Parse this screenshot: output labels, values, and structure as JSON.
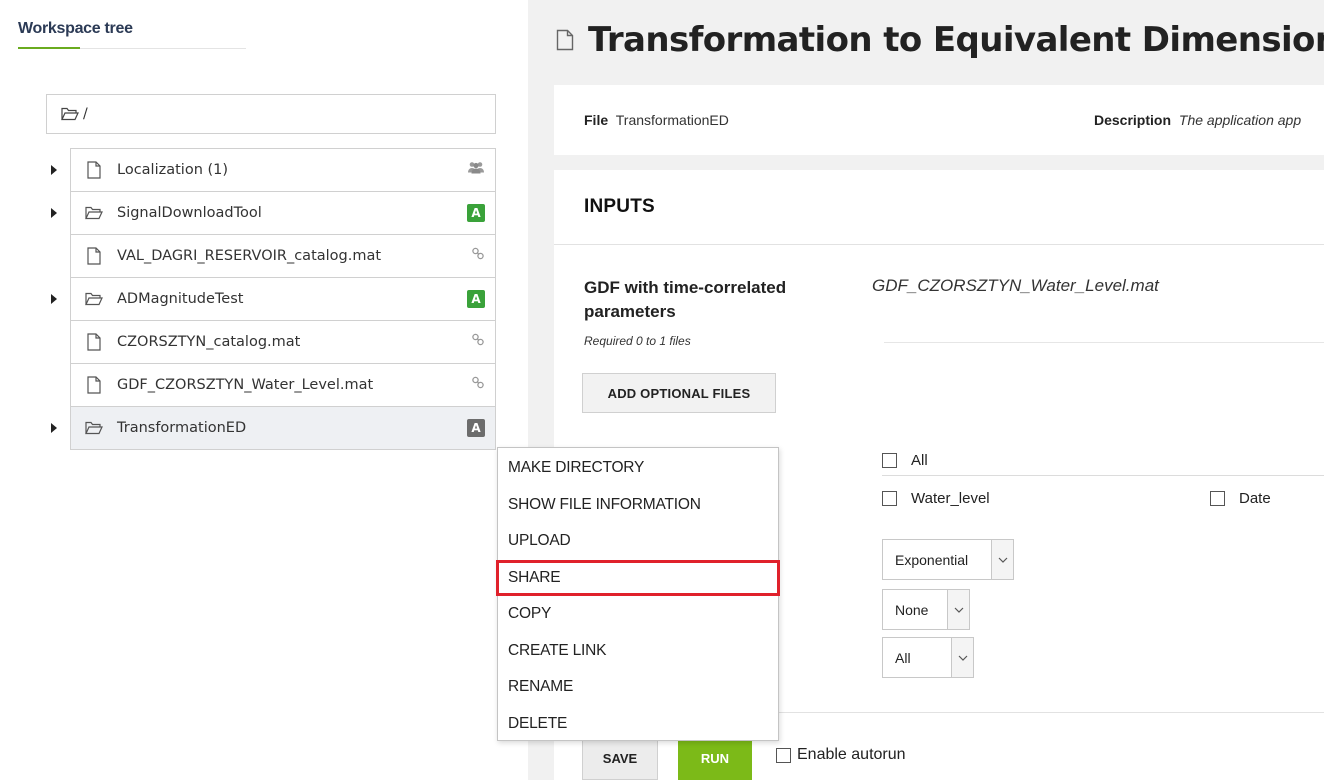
{
  "workspace": {
    "title": "Workspace tree",
    "path": "/",
    "items": [
      {
        "name": "Localization (1)",
        "type": "file",
        "expandable": true,
        "badge": "group-icon"
      },
      {
        "name": "SignalDownloadTool",
        "type": "folder",
        "expandable": true,
        "badge": "A",
        "badge_color": "#3aa23a"
      },
      {
        "name": "VAL_DAGRI_RESERVOIR_catalog.mat",
        "type": "file",
        "expandable": false,
        "badge": "link-icon"
      },
      {
        "name": "ADMagnitudeTest",
        "type": "folder",
        "expandable": true,
        "badge": "A",
        "badge_color": "#3aa23a"
      },
      {
        "name": "CZORSZTYN_catalog.mat",
        "type": "file",
        "expandable": false,
        "badge": "link-icon"
      },
      {
        "name": "GDF_CZORSZTYN_Water_Level.mat",
        "type": "file",
        "expandable": false,
        "badge": "link-icon"
      },
      {
        "name": "TransformationED",
        "type": "folder",
        "expandable": true,
        "badge": "A",
        "badge_color": "#6c6c6c",
        "selected": true
      }
    ]
  },
  "main": {
    "title": "Transformation to Equivalent Dimensions",
    "file_label": "File",
    "file_value": "TransformationED",
    "description_label": "Description",
    "description_value": "The application app",
    "inputs_heading": "INPUTS",
    "input": {
      "label": "GDF with time-correlated parameters",
      "requirement": "Required 0 to 1 files",
      "file": "GDF_CZORSZTYN_Water_Level.mat",
      "add_button": "ADD OPTIONAL FILES"
    },
    "checkboxes": {
      "all": "All",
      "water_level": "Water_level",
      "date": "Date"
    },
    "selects": {
      "first": "Exponential",
      "second": "None",
      "third": "All"
    },
    "save_button": "SAVE",
    "run_button": "RUN",
    "autorun_label": "Enable autorun"
  },
  "context_menu": {
    "items": [
      "MAKE DIRECTORY",
      "SHOW FILE INFORMATION",
      "UPLOAD",
      "SHARE",
      "COPY",
      "CREATE LINK",
      "RENAME",
      "DELETE"
    ],
    "highlighted": "SHARE",
    "highlight_color": "#e0212b"
  },
  "colors": {
    "accent_green": "#7cba18",
    "badge_green": "#3aa23a",
    "badge_grey": "#6c6c6c"
  }
}
